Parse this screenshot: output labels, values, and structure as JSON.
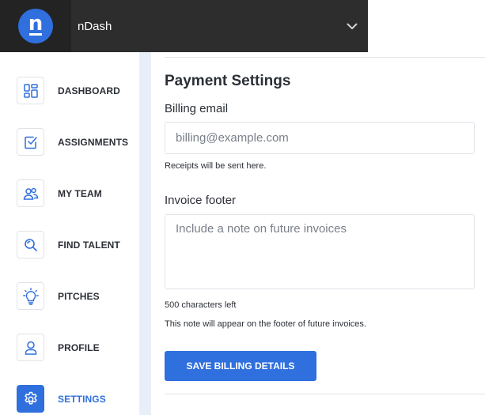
{
  "app": {
    "logo_letter": "n",
    "brand_name": "nDash",
    "accent_color": "#2f6fde"
  },
  "header": {
    "menu_icon": "chevron-down-icon"
  },
  "sidebar": {
    "items": [
      {
        "label": "DASHBOARD",
        "icon": "dashboard-grid-icon",
        "active": false
      },
      {
        "label": "ASSIGNMENTS",
        "icon": "checkbox-icon",
        "active": false
      },
      {
        "label": "MY TEAM",
        "icon": "team-icon",
        "active": false
      },
      {
        "label": "FIND TALENT",
        "icon": "search-icon",
        "active": false
      },
      {
        "label": "PITCHES",
        "icon": "lightbulb-icon",
        "active": false
      },
      {
        "label": "PROFILE",
        "icon": "user-icon",
        "active": false
      },
      {
        "label": "SETTINGS",
        "icon": "gear-icon",
        "active": true
      }
    ]
  },
  "main": {
    "section_title": "Payment Settings",
    "billing_email": {
      "label": "Billing email",
      "placeholder": "billing@example.com",
      "value": "",
      "help": "Receipts will be sent here."
    },
    "invoice_footer": {
      "label": "Invoice footer",
      "placeholder": "Include a note on future invoices",
      "value": "",
      "chars_left": "500 characters left",
      "help": "This note will appear on the footer of future invoices."
    },
    "save_button": "SAVE BILLING DETAILS"
  }
}
